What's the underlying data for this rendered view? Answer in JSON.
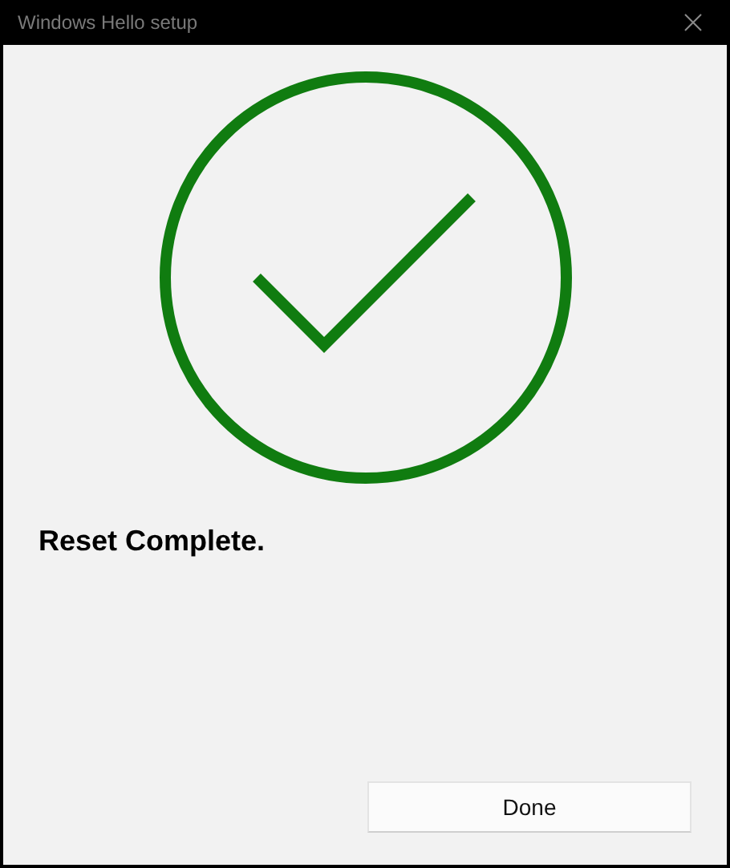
{
  "window": {
    "title": "Windows Hello setup"
  },
  "message": "Reset Complete.",
  "buttons": [
    "Done"
  ]
}
